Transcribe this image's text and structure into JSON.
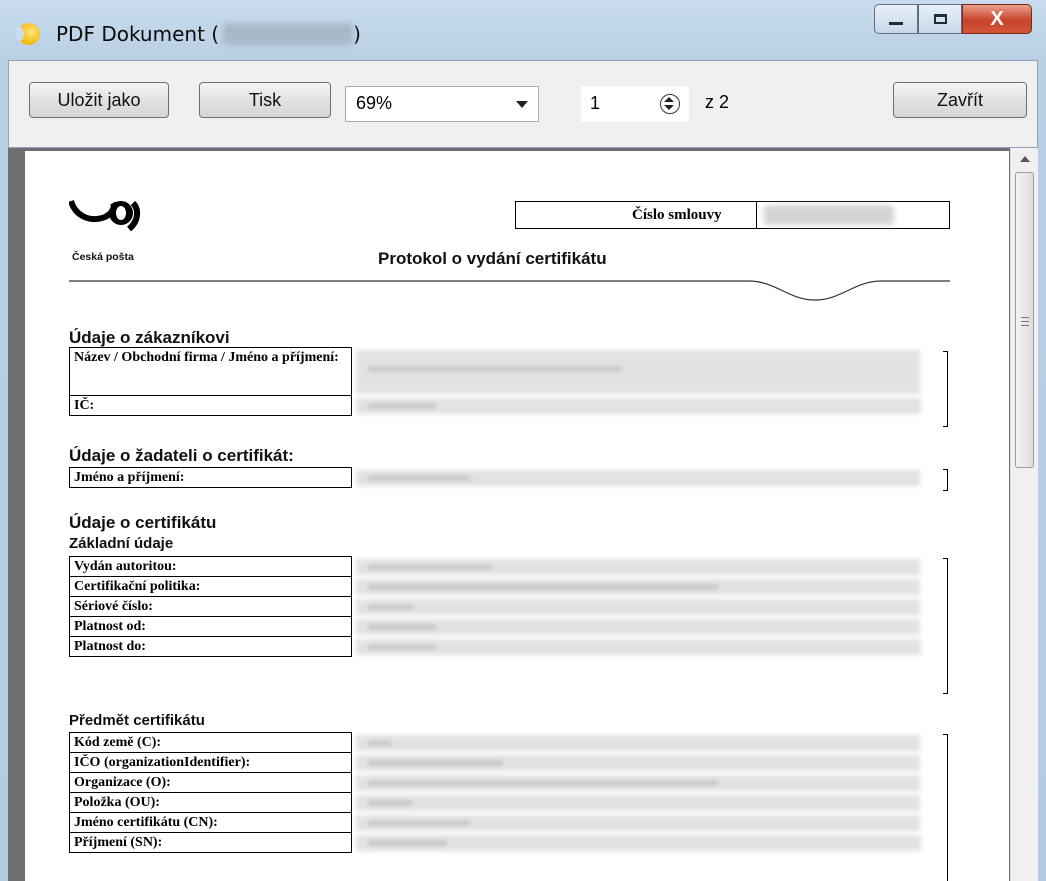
{
  "window": {
    "title": "PDF Dokument (",
    "title_close_paren": ")",
    "buttons": {
      "minimize": "minimize",
      "maximize": "maximize",
      "close": "X"
    }
  },
  "toolbar": {
    "save_as_label": "Uložit jako",
    "print_label": "Tisk",
    "zoom_value": "69%",
    "page_value": "1",
    "page_total": "z 2",
    "close_label": "Zavřít"
  },
  "document": {
    "logo_text": "Česká pošta",
    "contract_label": "Číslo smlouvy",
    "title": "Protokol o vydání certifikátu",
    "sections": {
      "customer": "Údaje o zákazníkovi",
      "applicant": "Údaje o žadateli o certifikát:",
      "certificate": "Údaje o certifikátu",
      "basic": "Základní údaje",
      "subject": "Předmět certifikátu"
    },
    "customer_rows": [
      "Název / Obchodní firma / Jméno a příjmení:",
      "IČ:"
    ],
    "applicant_rows": [
      "Jméno a příjmení:"
    ],
    "basic_rows": [
      "Vydán autoritou:",
      "Certifikační politika:",
      "Sériové číslo:",
      "Platnost od:",
      "Platnost do:"
    ],
    "subject_rows": [
      "Kód země (C):",
      "IČO (organizationIdentifier):",
      "Organizace (O):",
      "Položka (OU):",
      "Jméno certifikátu (CN):",
      "Příjmení (SN):"
    ]
  },
  "icons": {
    "app": "app-icon",
    "spinner": "spinner-icon",
    "scroll_up": "scroll-up-arrow-icon"
  }
}
